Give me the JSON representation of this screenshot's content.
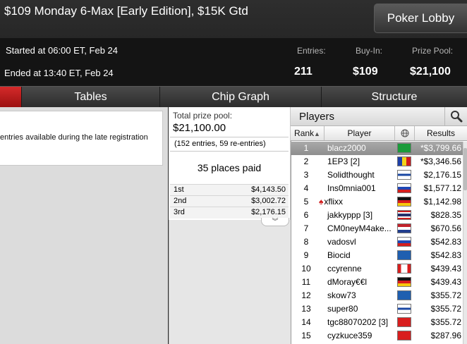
{
  "header": {
    "title": "$109 Monday 6-Max [Early Edition], $15K Gtd",
    "lobby_button": "Poker Lobby",
    "started": "Started at 06:00 ET, Feb 24",
    "ended": "Ended at 13:40 ET, Feb 24",
    "stats": {
      "entries_label": "Entries:",
      "entries_value": "211",
      "buyin_label": "Buy-In:",
      "buyin_value": "$109",
      "prizepool_label": "Prize Pool:",
      "prizepool_value": "$21,100"
    }
  },
  "tabs": {
    "tables": "Tables",
    "chip_graph": "Chip Graph",
    "structure": "Structure"
  },
  "left_panel": {
    "late_reg_text": "entries available during the late registration"
  },
  "prize": {
    "total_label": "Total prize pool:",
    "total_value": "$21,100.00",
    "entries_note": "(152 entries, 59 re-entries)",
    "places_paid": "35 places paid",
    "payouts": [
      {
        "place": "1st",
        "amount": "$4,143.50"
      },
      {
        "place": "2nd",
        "amount": "$3,002.72"
      },
      {
        "place": "3rd",
        "amount": "$2,176.15"
      }
    ],
    "expand_glyph": "︾"
  },
  "players": {
    "title": "Players",
    "columns": {
      "rank": "Rank",
      "player": "Player",
      "results": "Results"
    },
    "rows": [
      {
        "rank": "1",
        "name": "blacz2000",
        "result": "*$3,799.66",
        "flag": "brazil",
        "selected": true
      },
      {
        "rank": "2",
        "name": "1EP3 [2]",
        "result": "*$3,346.56",
        "flag": "moldova"
      },
      {
        "rank": "3",
        "name": "Solidthought",
        "result": "$2,176.15",
        "flag": "finland"
      },
      {
        "rank": "4",
        "name": "Ins0mnia001",
        "result": "$1,577.12",
        "flag": "russia"
      },
      {
        "rank": "5",
        "name": "xflixx",
        "result": "$1,142.98",
        "flag": "germany",
        "pro_badge": true
      },
      {
        "rank": "6",
        "name": "jakkyppp [3]",
        "result": "$828.35",
        "flag": "thailand"
      },
      {
        "rank": "7",
        "name": "CM0neyM4ake...",
        "result": "$670.56",
        "flag": "netherlands"
      },
      {
        "rank": "8",
        "name": "vadosvl",
        "result": "$542.83",
        "flag": "russia"
      },
      {
        "rank": "9",
        "name": "Biocid",
        "result": "$542.83",
        "flag": "sweden"
      },
      {
        "rank": "10",
        "name": "ccyrenne",
        "result": "$439.43",
        "flag": "canada"
      },
      {
        "rank": "11",
        "name": "dMoray€€l",
        "result": "$439.43",
        "flag": "germany"
      },
      {
        "rank": "12",
        "name": "skow73",
        "result": "$355.72",
        "flag": "sweden"
      },
      {
        "rank": "13",
        "name": "super80",
        "result": "$355.72",
        "flag": "finland"
      },
      {
        "rank": "14",
        "name": "tgc88070202 [3]",
        "result": "$355.72",
        "flag": "china"
      },
      {
        "rank": "15",
        "name": "cyzkuce359",
        "result": "$287.96",
        "flag": "china"
      }
    ]
  },
  "colors": {
    "accent_red": "#c41d1d",
    "selected_row": "#9b9b9b"
  }
}
